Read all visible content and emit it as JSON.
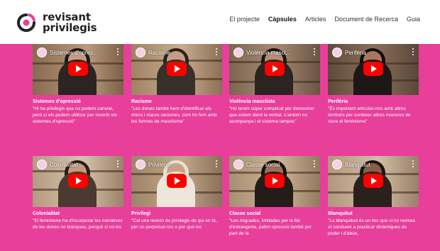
{
  "brand": {
    "line1": "revisant",
    "line2": "privilegis"
  },
  "nav": [
    {
      "label": "El projecte",
      "active": false
    },
    {
      "label": "Càpsules",
      "active": true
    },
    {
      "label": "Articles",
      "active": false
    },
    {
      "label": "Document de Recerca",
      "active": false
    },
    {
      "label": "Guia",
      "active": false
    }
  ],
  "cards": [
    {
      "video_title": "Sistemes d'opres...",
      "title": "Sistemes d'opressió",
      "quote": "\"Hi ha privilegis que no podem canviar, però sí els podem utilitzar per revertir els sistemes d'opressió\""
    },
    {
      "video_title": "Racisme",
      "title": "Racisme",
      "quote": "\"Les dones també hem d'identificar els micro i macro racismes, com ho fem amb les formes de masclisme\""
    },
    {
      "video_title": "Violència mascl...",
      "title": "Violència masclista",
      "quote": "\"Ho tenim súper complicat per demostrar que estem dient la veritat. L'entorn no acompanya i el sistema tampoc\""
    },
    {
      "video_title": "Perifèria",
      "title": "Perifèria",
      "quote": "\"És important articular-nos amb altres territoris per conèixer altres maneres de viure el feminisme\""
    },
    {
      "video_title": "Colonialitat",
      "title": "Colonialitat",
      "quote": "\"El feminisme ha d'incorporar les narratives de les dones no blanques, perquè si no les"
    },
    {
      "video_title": "Privilegis",
      "title": "Privilegi",
      "quote": "\"Cal una revisió de privilegis de qui en té, per no perpetuar-los o per què les"
    },
    {
      "video_title": "Classe social",
      "title": "Classe social",
      "quote": "\"Les migrades, limitades per la llei d'estrangeria, patim opressió també per part de la"
    },
    {
      "video_title": "Blanquitut",
      "title": "Blanquitut",
      "quote": "\"La blanquitud és un lloc que si no revises et condueix a practicar dinàmiques de poder i d'abús,"
    }
  ],
  "colors": {
    "background": "#e83f9b",
    "header": "#ffffff",
    "play": "#ff0000"
  }
}
